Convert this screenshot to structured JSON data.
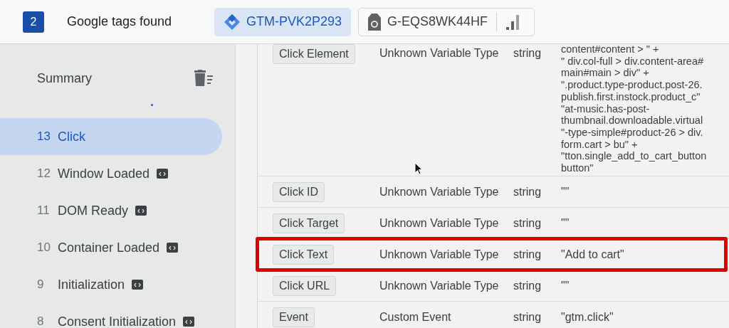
{
  "header": {
    "count": "2",
    "title": "Google tags found",
    "tags": [
      {
        "label": "GTM-PVK2P293",
        "kind": "gtm",
        "selected": true
      },
      {
        "label": "G-EQS8WK44HF",
        "kind": "ga",
        "selected": false
      }
    ]
  },
  "sidebar": {
    "title": "Summary",
    "items": [
      {
        "number": "13",
        "label": "Click",
        "selected": true,
        "code_badge": false
      },
      {
        "number": "12",
        "label": "Window Loaded",
        "selected": false,
        "code_badge": true
      },
      {
        "number": "11",
        "label": "DOM Ready",
        "selected": false,
        "code_badge": true
      },
      {
        "number": "10",
        "label": "Container Loaded",
        "selected": false,
        "code_badge": true
      },
      {
        "number": "9",
        "label": "Initialization",
        "selected": false,
        "code_badge": true
      },
      {
        "number": "8",
        "label": "Consent Initialization",
        "selected": false,
        "code_badge": true
      }
    ]
  },
  "variables": [
    {
      "name": "Click Element",
      "type": "Unknown Variable Type",
      "data_type": "string",
      "highlighted": false,
      "value_lines": [
        "content#content > \" +",
        "\" div.col-full > div.content-area#",
        "main#main > div\" +",
        "\".product.type-product.post-26.",
        "publish.first.instock.product_c\"",
        "\"at-music.has-post-",
        "thumbnail.downloadable.virtual",
        "\"-type-simple#product-26 > div.",
        "form.cart > bu\" +",
        "\"tton.single_add_to_cart_button",
        "button\""
      ]
    },
    {
      "name": "Click ID",
      "type": "Unknown Variable Type",
      "data_type": "string",
      "highlighted": false,
      "value_lines": [
        "\"\""
      ]
    },
    {
      "name": "Click Target",
      "type": "Unknown Variable Type",
      "data_type": "string",
      "highlighted": false,
      "value_lines": [
        "\"\""
      ]
    },
    {
      "name": "Click Text",
      "type": "Unknown Variable Type",
      "data_type": "string",
      "highlighted": true,
      "value_lines": [
        "\"Add to cart\""
      ]
    },
    {
      "name": "Click URL",
      "type": "Unknown Variable Type",
      "data_type": "string",
      "highlighted": false,
      "value_lines": [
        "\"\""
      ]
    },
    {
      "name": "Event",
      "type": "Custom Event",
      "data_type": "string",
      "highlighted": false,
      "value_lines": [
        "\"gtm.click\""
      ]
    }
  ]
}
